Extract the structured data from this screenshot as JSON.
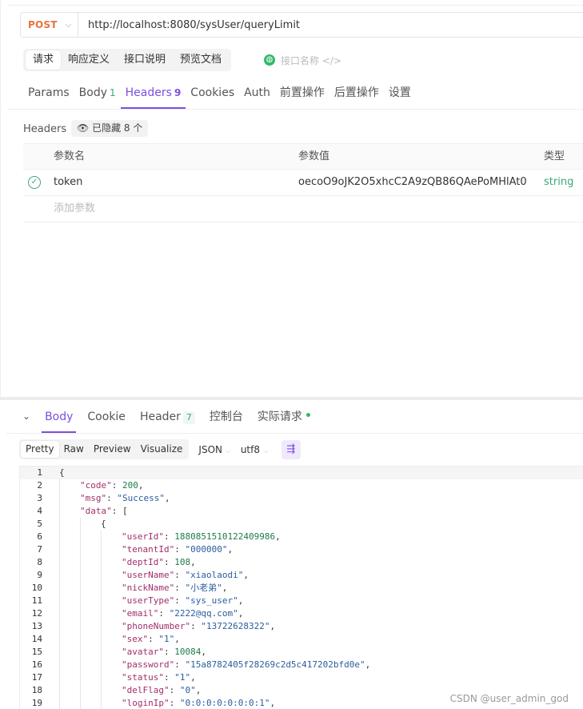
{
  "request": {
    "method": "POST",
    "url": "http://localhost:8080/sysUser/queryLimit"
  },
  "doc_tabs": [
    "请求",
    "响应定义",
    "接口说明",
    "预览文档"
  ],
  "api_name_placeholder": "接口名称",
  "param_tabs": [
    {
      "label": "Params",
      "count": ""
    },
    {
      "label": "Body",
      "count": "1"
    },
    {
      "label": "Headers",
      "count": "9"
    },
    {
      "label": "Cookies",
      "count": ""
    },
    {
      "label": "Auth",
      "count": ""
    },
    {
      "label": "前置操作",
      "count": ""
    },
    {
      "label": "后置操作",
      "count": ""
    },
    {
      "label": "设置",
      "count": ""
    }
  ],
  "headers_section": {
    "label": "Headers",
    "hidden_badge": "已隐藏 8 个",
    "columns": [
      "参数名",
      "参数值",
      "类型"
    ],
    "rows": [
      {
        "name": "token",
        "value": "oecoO9oJK2O5xhcC2A9zQB86QAePoMHlAt0",
        "type": "string"
      }
    ],
    "add_placeholder": "添加参数"
  },
  "response_tabs": [
    {
      "label": "Body",
      "count": ""
    },
    {
      "label": "Cookie",
      "count": ""
    },
    {
      "label": "Header",
      "count": "7"
    },
    {
      "label": "控制台",
      "count": ""
    },
    {
      "label": "实际请求",
      "count": ""
    }
  ],
  "view_modes": [
    "Pretty",
    "Raw",
    "Preview",
    "Visualize"
  ],
  "format_select": "JSON",
  "encoding_select": "utf8",
  "code_lines": [
    {
      "n": "1",
      "indent": 0,
      "parts": [
        [
          "p",
          "{"
        ]
      ]
    },
    {
      "n": "2",
      "indent": 1,
      "parts": [
        [
          "k",
          "\"code\""
        ],
        [
          "p",
          ": "
        ],
        [
          "n",
          "200"
        ],
        [
          "p",
          ","
        ]
      ]
    },
    {
      "n": "3",
      "indent": 1,
      "parts": [
        [
          "k",
          "\"msg\""
        ],
        [
          "p",
          ": "
        ],
        [
          "s",
          "\"Success\""
        ],
        [
          "p",
          ","
        ]
      ]
    },
    {
      "n": "4",
      "indent": 1,
      "parts": [
        [
          "k",
          "\"data\""
        ],
        [
          "p",
          ": ["
        ]
      ]
    },
    {
      "n": "5",
      "indent": 2,
      "parts": [
        [
          "p",
          "{"
        ]
      ]
    },
    {
      "n": "6",
      "indent": 3,
      "parts": [
        [
          "k",
          "\"userId\""
        ],
        [
          "p",
          ": "
        ],
        [
          "n",
          "1880851510122409986"
        ],
        [
          "p",
          ","
        ]
      ]
    },
    {
      "n": "7",
      "indent": 3,
      "parts": [
        [
          "k",
          "\"tenantId\""
        ],
        [
          "p",
          ": "
        ],
        [
          "s",
          "\"000000\""
        ],
        [
          "p",
          ","
        ]
      ]
    },
    {
      "n": "8",
      "indent": 3,
      "parts": [
        [
          "k",
          "\"deptId\""
        ],
        [
          "p",
          ": "
        ],
        [
          "n",
          "108"
        ],
        [
          "p",
          ","
        ]
      ]
    },
    {
      "n": "9",
      "indent": 3,
      "parts": [
        [
          "k",
          "\"userName\""
        ],
        [
          "p",
          ": "
        ],
        [
          "s",
          "\"xiaolaodi\""
        ],
        [
          "p",
          ","
        ]
      ]
    },
    {
      "n": "10",
      "indent": 3,
      "parts": [
        [
          "k",
          "\"nickName\""
        ],
        [
          "p",
          ": "
        ],
        [
          "s",
          "\"小老弟\""
        ],
        [
          "p",
          ","
        ]
      ]
    },
    {
      "n": "11",
      "indent": 3,
      "parts": [
        [
          "k",
          "\"userType\""
        ],
        [
          "p",
          ": "
        ],
        [
          "s",
          "\"sys_user\""
        ],
        [
          "p",
          ","
        ]
      ]
    },
    {
      "n": "12",
      "indent": 3,
      "parts": [
        [
          "k",
          "\"email\""
        ],
        [
          "p",
          ": "
        ],
        [
          "s",
          "\"2222@qq.com\""
        ],
        [
          "p",
          ","
        ]
      ]
    },
    {
      "n": "13",
      "indent": 3,
      "parts": [
        [
          "k",
          "\"phoneNumber\""
        ],
        [
          "p",
          ": "
        ],
        [
          "s",
          "\"13722628322\""
        ],
        [
          "p",
          ","
        ]
      ]
    },
    {
      "n": "14",
      "indent": 3,
      "parts": [
        [
          "k",
          "\"sex\""
        ],
        [
          "p",
          ": "
        ],
        [
          "s",
          "\"1\""
        ],
        [
          "p",
          ","
        ]
      ]
    },
    {
      "n": "15",
      "indent": 3,
      "parts": [
        [
          "k",
          "\"avatar\""
        ],
        [
          "p",
          ": "
        ],
        [
          "n",
          "10084"
        ],
        [
          "p",
          ","
        ]
      ]
    },
    {
      "n": "16",
      "indent": 3,
      "parts": [
        [
          "k",
          "\"password\""
        ],
        [
          "p",
          ": "
        ],
        [
          "s",
          "\"15a8782405f28269c2d5c417202bfd0e\""
        ],
        [
          "p",
          ","
        ]
      ]
    },
    {
      "n": "17",
      "indent": 3,
      "parts": [
        [
          "k",
          "\"status\""
        ],
        [
          "p",
          ": "
        ],
        [
          "s",
          "\"1\""
        ],
        [
          "p",
          ","
        ]
      ]
    },
    {
      "n": "18",
      "indent": 3,
      "parts": [
        [
          "k",
          "\"delFlag\""
        ],
        [
          "p",
          ": "
        ],
        [
          "s",
          "\"0\""
        ],
        [
          "p",
          ","
        ]
      ]
    },
    {
      "n": "19",
      "indent": 3,
      "parts": [
        [
          "k",
          "\"loginIp\""
        ],
        [
          "p",
          ": "
        ],
        [
          "s",
          "\"0:0:0:0:0:0:0:1\""
        ],
        [
          "p",
          ","
        ]
      ]
    }
  ],
  "watermark": "CSDN @user_admin_god",
  "colors": {
    "accent": "#7b4fe0",
    "method": "#e8723a",
    "success": "#3aa77a"
  }
}
